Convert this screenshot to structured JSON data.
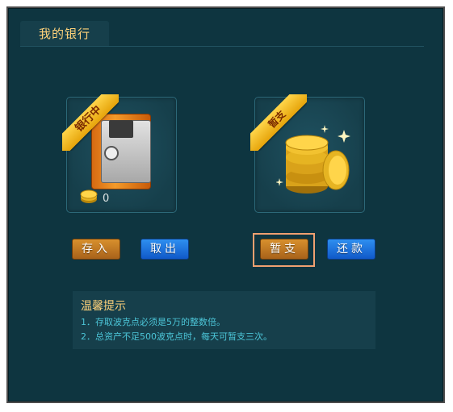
{
  "header": {
    "title": "我的银行"
  },
  "bank_card": {
    "ribbon_label": "银行中",
    "coin_count": "0"
  },
  "borrow_card": {
    "ribbon_label": "暂支"
  },
  "buttons": {
    "deposit": "存入",
    "withdraw": "取出",
    "borrow": "暂支",
    "repay": "还款"
  },
  "tips": {
    "title": "温馨提示",
    "line1": "1．存取波克点必须是5万的整数倍。",
    "line2": "2．总资产不足500波克点时，每天可暂支三次。"
  },
  "colors": {
    "background": "#0e3540",
    "panel": "#163f4b",
    "title_gold": "#ffd27a",
    "tip_text": "#4cc6d8",
    "button_gold": "#c07a22",
    "button_blue": "#1f74dd",
    "highlight_border": "#f0a070"
  }
}
